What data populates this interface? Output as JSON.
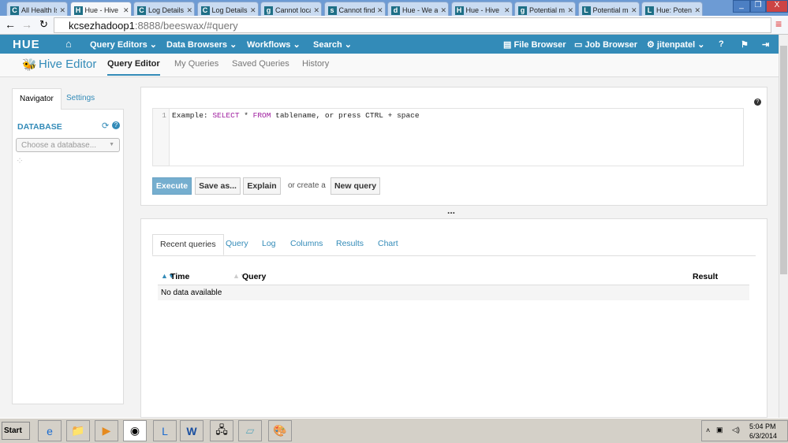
{
  "browser": {
    "tabs": [
      {
        "label": "All Health Is",
        "icon": "C"
      },
      {
        "label": "Hue - Hive E",
        "icon": "H",
        "active": true
      },
      {
        "label": "Log Details",
        "icon": "C"
      },
      {
        "label": "Log Details",
        "icon": "C"
      },
      {
        "label": "Cannot loca",
        "icon": "g"
      },
      {
        "label": "Cannot find",
        "icon": "s"
      },
      {
        "label": "Hue - We ar",
        "icon": "d"
      },
      {
        "label": "Hue - Hive E",
        "icon": "H"
      },
      {
        "label": "Potential mi",
        "icon": "g"
      },
      {
        "label": "Potential mi",
        "icon": "L"
      },
      {
        "label": "Hue: Poten",
        "icon": "L"
      }
    ],
    "url_host": "kcsezhadoop1",
    "url_rest": ":8888/beeswax/#query"
  },
  "nav": {
    "logo": "HUE",
    "items": [
      "Query Editors",
      "Data Browsers",
      "Workflows",
      "Search"
    ],
    "file_browser": "File Browser",
    "job_browser": "Job Browser",
    "user": "jitenpatel"
  },
  "subnav": {
    "app": "Hive Editor",
    "links": [
      "Query Editor",
      "My Queries",
      "Saved Queries",
      "History"
    ]
  },
  "left": {
    "tabs": [
      "Navigator",
      "Settings"
    ],
    "database_label": "DATABASE",
    "db_placeholder": "Choose a database..."
  },
  "editor": {
    "line": "1",
    "pre": "Example: ",
    "kw1": "SELECT",
    "mid": " * ",
    "kw2": "FROM",
    "post": " tablename, or press CTRL + space",
    "execute": "Execute",
    "save_as": "Save as...",
    "explain": "Explain",
    "or_create": "or create a",
    "new_query": "New query",
    "help": "?",
    "resize": "..."
  },
  "results": {
    "tabs": [
      "Recent queries",
      "Query",
      "Log",
      "Columns",
      "Results",
      "Chart"
    ],
    "columns": [
      "Time",
      "Query",
      "Result"
    ],
    "empty": "No data available"
  },
  "taskbar": {
    "start": "Start",
    "time": "5:04 PM",
    "date": "6/3/2014"
  }
}
